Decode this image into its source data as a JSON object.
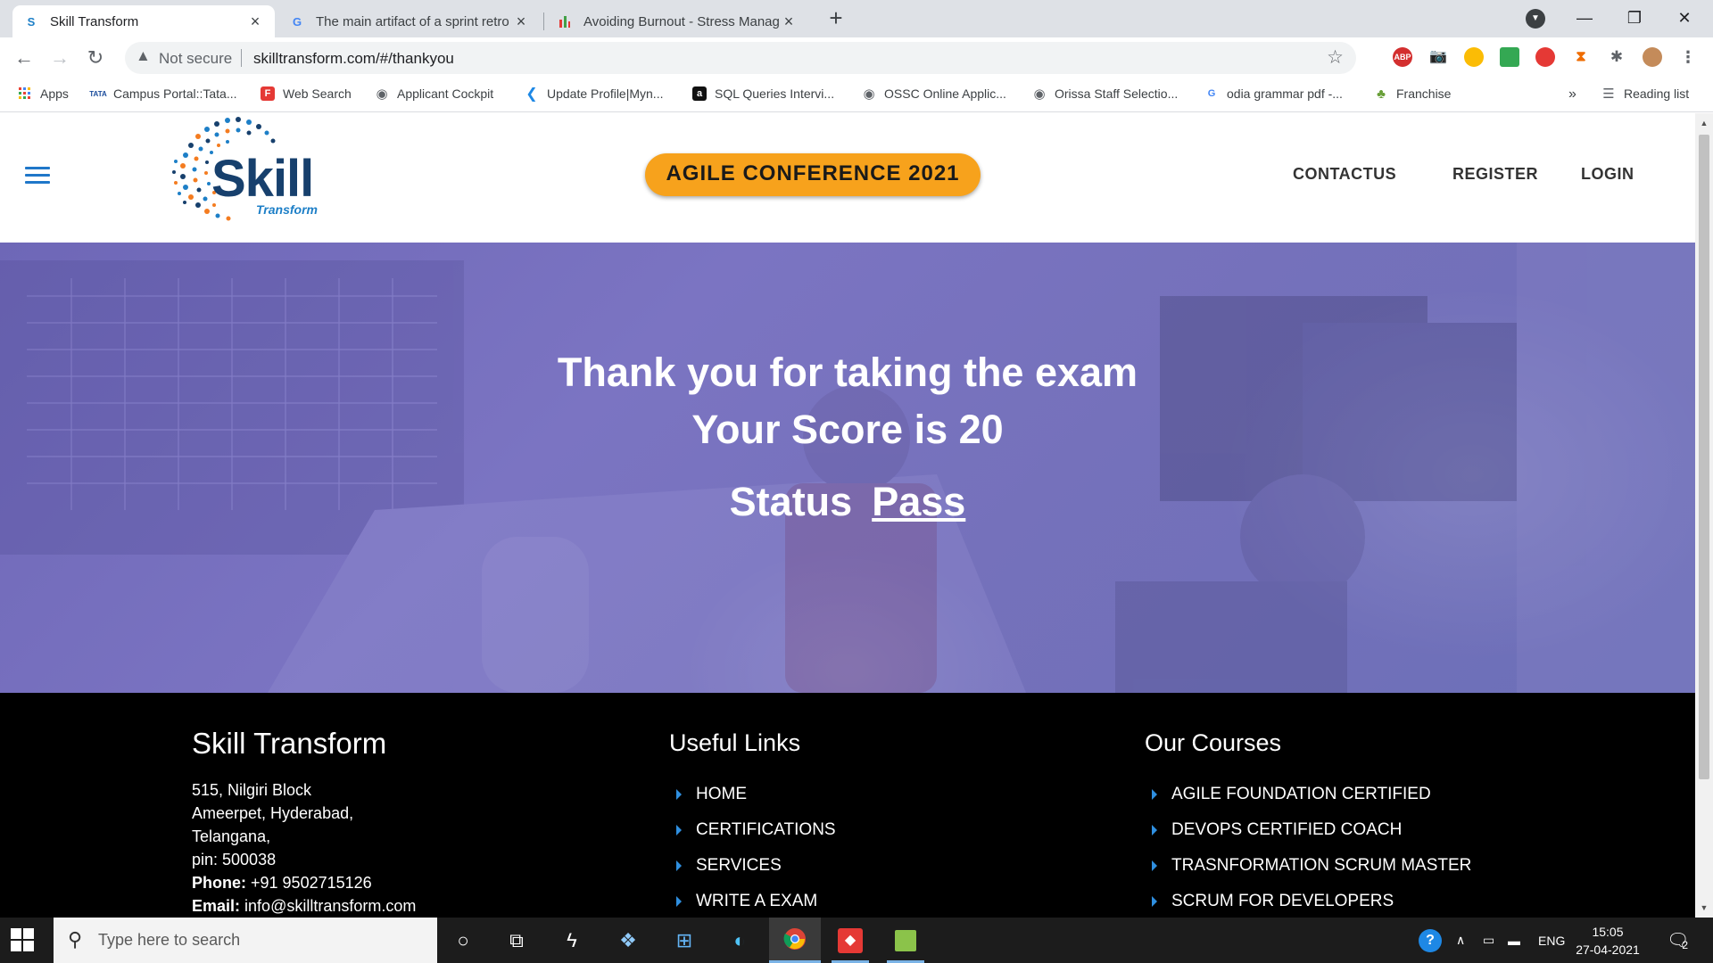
{
  "browser": {
    "tabs": [
      {
        "title": "Skill Transform",
        "active": true
      },
      {
        "title": "The main artifact of a sprint retro",
        "active": false
      },
      {
        "title": "Avoiding Burnout - Stress Manag",
        "active": false
      }
    ],
    "address": {
      "security": "Not secure",
      "url": "skilltransform.com/#/thankyou"
    },
    "bookmarks": [
      {
        "label": "Apps"
      },
      {
        "label": "Campus Portal::Tata..."
      },
      {
        "label": "Web Search"
      },
      {
        "label": "Applicant Cockpit"
      },
      {
        "label": "Update Profile|Myn..."
      },
      {
        "label": "SQL Queries Intervi..."
      },
      {
        "label": "OSSC Online Applic..."
      },
      {
        "label": "Orissa Staff Selectio..."
      },
      {
        "label": "odia grammar pdf -..."
      },
      {
        "label": "Franchise"
      }
    ],
    "bookmarks_overflow": "»",
    "reading_list": "Reading list",
    "extensions": [
      "ABP"
    ]
  },
  "site": {
    "logo": {
      "word": "Skill",
      "sub": "Transform"
    },
    "conference_label": "AGILE CONFERENCE 2021",
    "nav": {
      "contact": "CONTACTUS",
      "register": "REGISTER",
      "login": "LOGIN"
    }
  },
  "hero": {
    "line1": "Thank you for taking the exam",
    "line2": "Your Score is 20",
    "status_label": "Status",
    "status_value": "Pass"
  },
  "footer": {
    "brand": "Skill Transform",
    "address_lines": [
      "515, Nilgiri Block",
      "Ameerpet, Hyderabad,",
      "Telangana,",
      "pin: 500038"
    ],
    "phone_label": "Phone:",
    "phone": "+91 9502715126",
    "email_label": "Email:",
    "email": "info@skilltransform.com",
    "useful_links_title": "Useful Links",
    "useful_links": [
      "HOME",
      "CERTIFICATIONS",
      "SERVICES",
      "WRITE A EXAM"
    ],
    "courses_title": "Our Courses",
    "courses": [
      "AGILE FOUNDATION CERTIFIED",
      "DEVOPS CERTIFIED COACH",
      "TRASNFORMATION SCRUM MASTER",
      "SCRUM FOR DEVELOPERS"
    ]
  },
  "taskbar": {
    "search_placeholder": "Type here to search",
    "language": "ENG",
    "time": "15:05",
    "date": "27-04-2021",
    "notification_count": "2"
  },
  "colors": {
    "accent_orange": "#f7a21c",
    "hero_overlay": "#7b74c2",
    "brand_blue": "#17406d",
    "link_arrow": "#2f8fe0"
  }
}
